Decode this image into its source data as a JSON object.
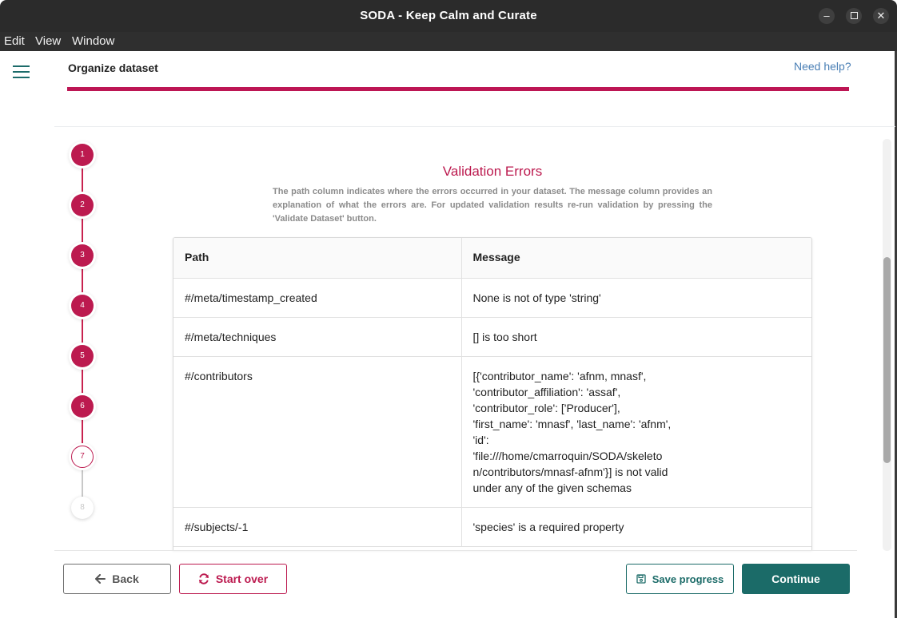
{
  "window": {
    "title": "SODA - Keep Calm and Curate",
    "minimize_glyph": "–",
    "close_glyph": "✕"
  },
  "menu": [
    "Edit",
    "View",
    "Window"
  ],
  "header": {
    "page_title": "Organize dataset",
    "help_link": "Need help?",
    "accent_color": "#bd1654"
  },
  "stepper": {
    "steps": [
      {
        "label": "1",
        "state": "done"
      },
      {
        "label": "2",
        "state": "done"
      },
      {
        "label": "3",
        "state": "done"
      },
      {
        "label": "4",
        "state": "done"
      },
      {
        "label": "5",
        "state": "done"
      },
      {
        "label": "6",
        "state": "done"
      },
      {
        "label": "7",
        "state": "active"
      },
      {
        "label": "8",
        "state": "todo"
      }
    ]
  },
  "validation": {
    "title": "Validation Errors",
    "description": "The path column indicates where the errors occurred in your dataset. The message column provides an explanation of what the errors are. For updated validation results re-run validation by pressing the 'Validate Dataset' button.",
    "columns": [
      "Path",
      "Message"
    ],
    "rows": [
      {
        "path": "#/meta/timestamp_created",
        "message": "None is not of type 'string'"
      },
      {
        "path": "#/meta/techniques",
        "message": "[] is too short"
      },
      {
        "path": "#/contributors",
        "message": "[{'contributor_name': 'afnm, mnasf',\n'contributor_affiliation': 'assaf',\n'contributor_role': ['Producer'],\n'first_name': 'mnasf', 'last_name': 'afnm',\n'id':\n'file:///home/cmarroquin/SODA/skeleto\nn/contributors/mnasf-afnm'}] is not valid\nunder any of the given schemas"
      },
      {
        "path": "#/subjects/-1",
        "message": "'species' is a required property"
      }
    ]
  },
  "footer": {
    "back": "Back",
    "start_over": "Start over",
    "save_progress": "Save progress",
    "continue": "Continue",
    "teal_color": "#1b6b68"
  }
}
